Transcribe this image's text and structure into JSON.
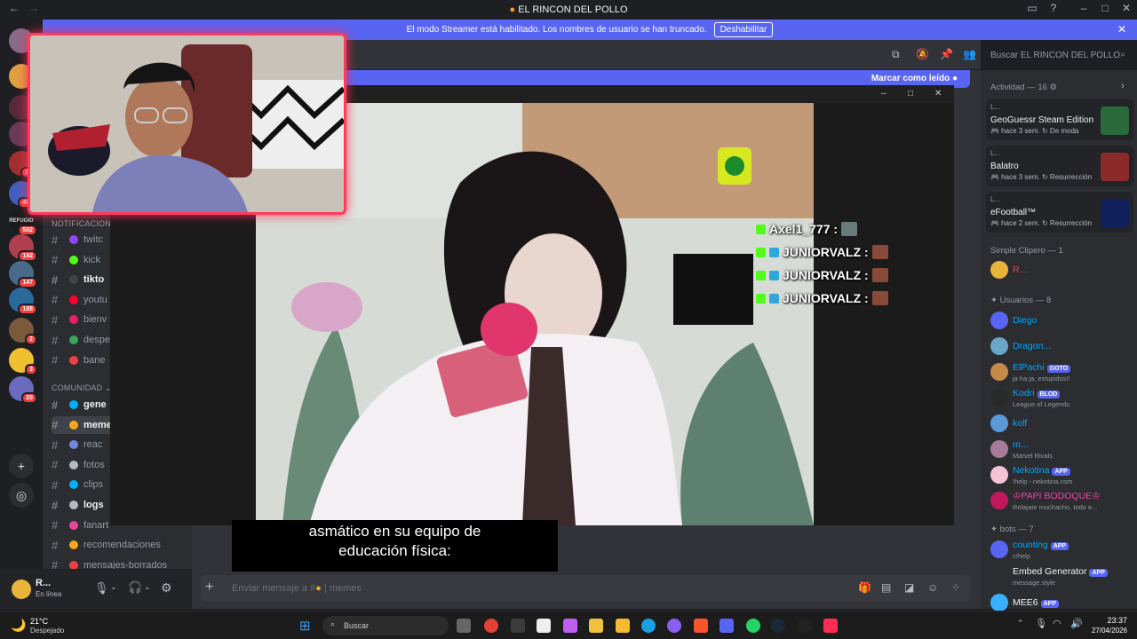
{
  "window": {
    "title": "EL RINCON DEL POLLO"
  },
  "banner": {
    "text": "El modo Streamer está habilitado. Los nombres de usuario se han truncado.",
    "button": "Deshabilitar"
  },
  "servers": [
    {
      "label": "",
      "badge": ""
    },
    {
      "label": "",
      "badge": ""
    },
    {
      "label": "",
      "badge": ""
    },
    {
      "label": "",
      "badge": ""
    },
    {
      "label": "",
      "badge": "1K"
    },
    {
      "label": "",
      "badge": "407"
    },
    {
      "label": "REFUGIO",
      "badge": "502"
    },
    {
      "label": "",
      "badge": "192"
    },
    {
      "label": "",
      "badge": "147"
    },
    {
      "label": "",
      "badge": "188"
    },
    {
      "label": "",
      "badge": "2"
    },
    {
      "label": "",
      "badge": "3"
    },
    {
      "label": "",
      "badge": "25"
    }
  ],
  "channels": {
    "categories": [
      "NOTIFICACIONES",
      "COMUNIDAD"
    ],
    "notif": [
      {
        "name": "twitc",
        "color": "#9146ff",
        "unread": false
      },
      {
        "name": "kick",
        "color": "#53fc18",
        "unread": false
      },
      {
        "name": "tikto",
        "color": "#444",
        "unread": true
      },
      {
        "name": "youtu",
        "color": "#ff0033",
        "unread": false
      },
      {
        "name": "bienv",
        "color": "#e91e63",
        "unread": false
      },
      {
        "name": "despe",
        "color": "#3ba55c",
        "unread": false
      },
      {
        "name": "bane",
        "color": "#ed4245",
        "unread": false
      }
    ],
    "comunidad": [
      {
        "name": "gene",
        "color": "#00b0f4",
        "unread": true
      },
      {
        "name": "meme",
        "color": "#faa61a",
        "unread": true
      },
      {
        "name": "reac",
        "color": "#7289da",
        "unread": false
      },
      {
        "name": "fotos",
        "color": "#b5bac1",
        "unread": false
      },
      {
        "name": "clips",
        "color": "#00b0f4",
        "unread": false
      },
      {
        "name": "logs",
        "color": "#b5bac1",
        "unread": true
      },
      {
        "name": "fanart",
        "color": "#eb459e",
        "unread": false
      },
      {
        "name": "recomendaciones",
        "color": "#faa61a",
        "unread": false
      },
      {
        "name": "mensajes-borrados",
        "color": "#ed4245",
        "unread": false
      }
    ]
  },
  "user": {
    "name": "R...",
    "status": "En línea"
  },
  "header": {
    "search_placeholder": "Buscar EL RINCON DEL POLLO",
    "mark_read": "Marcar como leído"
  },
  "video": {
    "subtitle_1": "asmático en su equipo de",
    "subtitle_2": "educación física:",
    "overlay_chat": [
      "Axel1_777 :",
      "JUNIORVALZ :",
      "JUNIORVALZ :",
      "JUNIORVALZ :"
    ]
  },
  "composer": {
    "placeholder": "Enviar mensaje a #",
    "channel": "memes"
  },
  "right": {
    "activity_header": "Actividad — 16",
    "activities": [
      {
        "user": "L...",
        "name": "GeoGuessr Steam Edition",
        "time": "hace 3 sem.",
        "tag": "De moda",
        "color": "#2a6a3a"
      },
      {
        "user": "L...",
        "name": "Balatro",
        "time": "hace 3 sem.",
        "tag": "Resurrección",
        "color": "#8a2a2a"
      },
      {
        "user": "L...",
        "name": "eFootball™",
        "time": "hace 2 sem.",
        "tag": "Resurrección",
        "color": "#10205a"
      }
    ],
    "group1_header": "Simple Clipero — 1",
    "group1": [
      {
        "name": "R...",
        "sub": "",
        "color": "#e8b43a",
        "name_color": "#ed4245",
        "tag": ""
      }
    ],
    "group2_header": "Usuarios — 8",
    "group2": [
      {
        "name": "Diego",
        "sub": "",
        "color": "#5865f2",
        "name_color": "#00a8fc",
        "tag": ""
      },
      {
        "name": "Dragon...",
        "sub": "",
        "color": "#6aa6c8",
        "name_color": "#00a8fc",
        "tag": ""
      },
      {
        "name": "ElPachi",
        "sub": "ja ha ja, estupidos!!",
        "color": "#c38a4a",
        "name_color": "#00a8fc",
        "tag": "GOTO"
      },
      {
        "name": "Kodri",
        "sub": "League of Legends",
        "color": "#2a2a2a",
        "name_color": "#00a8fc",
        "tag": "BLOD"
      },
      {
        "name": "kolf",
        "sub": "",
        "color": "#5a9ad8",
        "name_color": "#00a8fc",
        "tag": ""
      },
      {
        "name": "m...",
        "sub": "Marvel Rivals",
        "color": "#a87a9a",
        "name_color": "#00a8fc",
        "tag": ""
      },
      {
        "name": "Nekotina",
        "sub": "!help - nekotina.com",
        "color": "#f4c4d4",
        "name_color": "#00a8fc",
        "tag": "APP"
      },
      {
        "name": "♔PAPI BODOQUE♔",
        "sub": "Relajate muchacho, todo e...",
        "color": "#c2185b",
        "name_color": "#eb459e",
        "tag": ""
      }
    ],
    "group3_header": "bots — 7",
    "group3": [
      {
        "name": "counting",
        "sub": "c!help",
        "color": "#5865f2",
        "name_color": "#00a8fc",
        "tag": "APP"
      },
      {
        "name": "Embed Generator",
        "sub": "message.style",
        "color": "#2b2d31",
        "name_color": "#f2f3f5",
        "tag": "APP"
      },
      {
        "name": "MEE6",
        "sub": "",
        "color": "#3ab0ff",
        "name_color": "#f2f3f5",
        "tag": "APP"
      }
    ]
  },
  "taskbar": {
    "weather_temp": "21°C",
    "weather_desc": "Despejado",
    "search": "Buscar",
    "time": "23:37",
    "date": "27/04/2026"
  }
}
